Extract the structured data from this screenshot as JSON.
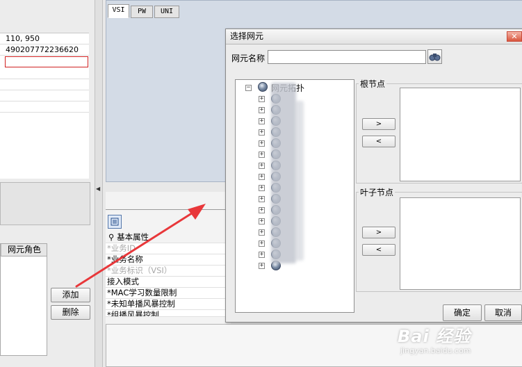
{
  "left_grid": {
    "rows": [
      "110, 950",
      "490207772236620",
      "",
      "",
      "",
      "",
      ""
    ]
  },
  "role_panel": {
    "header": "网元角色",
    "add_label": "添加",
    "delete_label": "删除"
  },
  "tabs": [
    "VSI",
    "PW",
    "UNI"
  ],
  "properties": {
    "section": "基本属性",
    "rows": [
      {
        "text": "*业务ID",
        "grey": true
      },
      {
        "text": "*业务名称",
        "grey": false
      },
      {
        "text": "*业务标识（VSI）",
        "grey": true
      },
      {
        "text": " 接入模式",
        "grey": false
      },
      {
        "text": "*MAC学习数量限制",
        "grey": false
      },
      {
        "text": "*未知单播风暴控制",
        "grey": false
      },
      {
        "text": "*组播风暴控制",
        "grey": false
      }
    ]
  },
  "dialog": {
    "title": "选择网元",
    "close_icon": "close-icon",
    "name_label": "网元名称",
    "name_value": "",
    "tree_root": "网元拓扑",
    "tree_child_count": 16,
    "root_group": "根节点",
    "leaf_group": "叶子节点",
    "arrow_right": ">",
    "arrow_left": "<",
    "confirm_label": "确定",
    "cancel_label": "取消"
  },
  "watermark": {
    "main": "Bai 经验",
    "sub": "jingyan.baidu.com"
  },
  "colors": {
    "canvas": "#d3dbe6",
    "annotation_arrow": "#e8373a",
    "selection_border": "#d02020"
  }
}
